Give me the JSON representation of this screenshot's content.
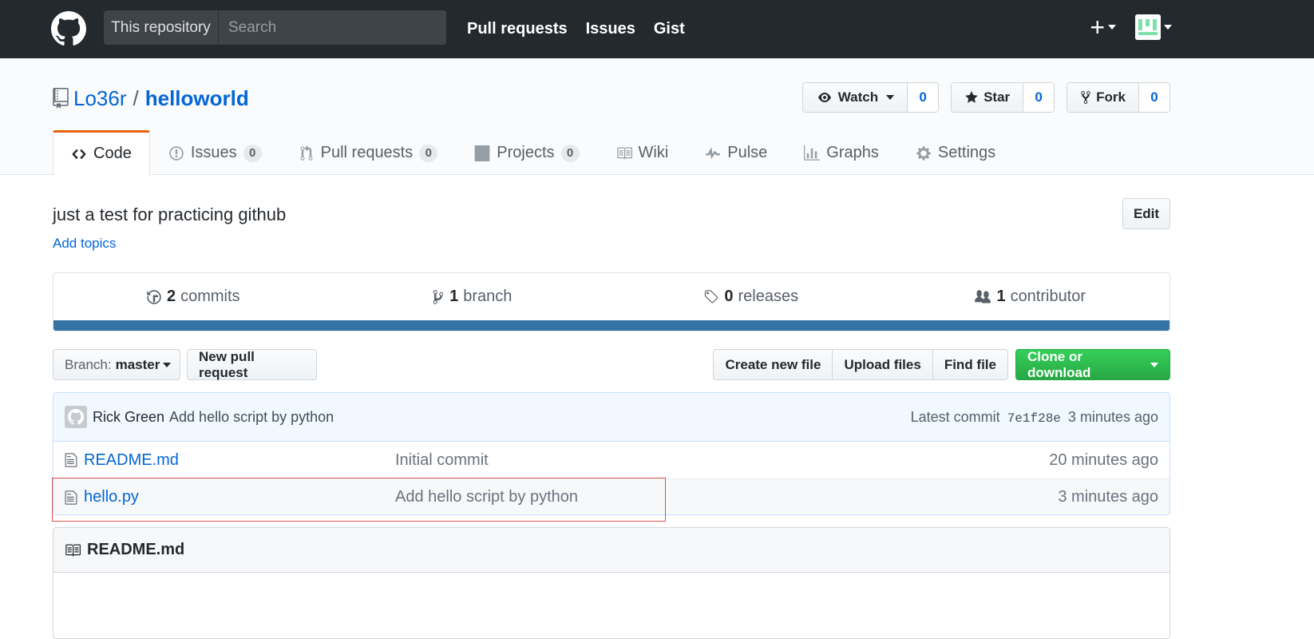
{
  "header": {
    "search_scope": "This repository",
    "search_placeholder": "Search",
    "nav": [
      "Pull requests",
      "Issues",
      "Gist"
    ],
    "plus_label": "+"
  },
  "repo": {
    "owner": "Lo36r",
    "separator": "/",
    "name": "helloworld"
  },
  "actions": {
    "watch_label": "Watch",
    "watch_count": "0",
    "star_label": "Star",
    "star_count": "0",
    "fork_label": "Fork",
    "fork_count": "0"
  },
  "tabs": [
    {
      "label": "Code"
    },
    {
      "label": "Issues",
      "count": "0"
    },
    {
      "label": "Pull requests",
      "count": "0"
    },
    {
      "label": "Projects",
      "count": "0"
    },
    {
      "label": "Wiki"
    },
    {
      "label": "Pulse"
    },
    {
      "label": "Graphs"
    },
    {
      "label": "Settings"
    }
  ],
  "description": "just a test for practicing github",
  "add_topics": "Add topics",
  "edit_label": "Edit",
  "summary": {
    "commits_num": "2",
    "commits_label": "commits",
    "branch_num": "1",
    "branch_label": "branch",
    "releases_num": "0",
    "releases_label": "releases",
    "contributor_num": "1",
    "contributor_label": "contributor",
    "language_color": "#3572a5"
  },
  "file_nav": {
    "branch_label": "Branch:",
    "branch_name": "master",
    "new_pr": "New pull request",
    "create_file": "Create new file",
    "upload_files": "Upload files",
    "find_file": "Find file",
    "clone": "Clone or download"
  },
  "commit": {
    "author": "Rick Green",
    "message": "Add hello script by python",
    "latest_label": "Latest commit",
    "sha": "7e1f28e",
    "age": "3 minutes ago"
  },
  "files": [
    {
      "name": "README.md",
      "message": "Initial commit",
      "age": "20 minutes ago"
    },
    {
      "name": "hello.py",
      "message": "Add hello script by python",
      "age": "3 minutes ago"
    }
  ],
  "readme_title": "README.md",
  "colors": {
    "header_bg": "#24292e",
    "link": "#0366d6",
    "selected_tab_border": "#e36209",
    "clone_green": "#28a745",
    "highlight_red": "#d9534f"
  }
}
